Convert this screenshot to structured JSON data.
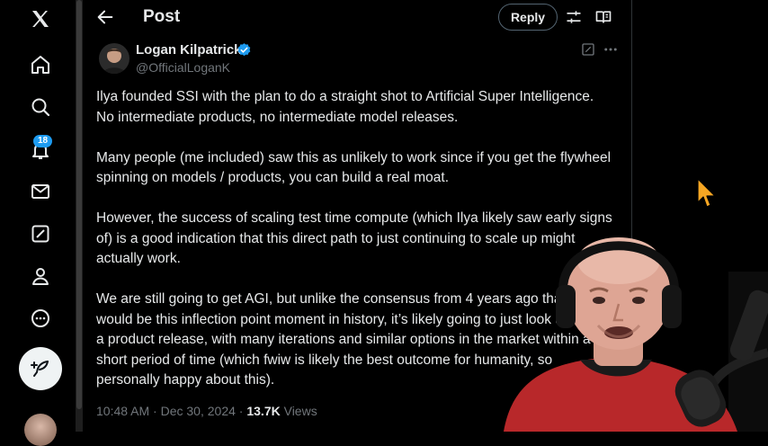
{
  "nav": {
    "notifications_badge": "18",
    "items": [
      "x-logo-icon",
      "home-icon",
      "search-icon",
      "bell-icon",
      "mail-icon",
      "grok-icon",
      "profile-icon",
      "more-circle-icon"
    ]
  },
  "header": {
    "title": "Post",
    "reply_label": "Reply"
  },
  "post": {
    "author_name": "Logan Kilpatrick",
    "handle": "@OfficialLoganK",
    "paragraphs": [
      "Ilya founded SSI with the plan to do a straight shot to Artificial Super Intelligence. No intermediate products, no intermediate model releases.",
      "Many people (me included) saw this as unlikely to work since if you get the flywheel spinning on models / products, you can build a real moat.",
      "However, the success of scaling test time compute (which Ilya likely saw early signs of) is a good indication that this direct path to just continuing to scale up might actually work.",
      "We are still going to get AGI, but unlike the consensus from 4 years ago that it would be this inflection point moment in history, it’s likely going to just look a lot like a product release, with many iterations and similar options in the market within a short period of time (which fwiw is likely the best outcome for humanity, so personally happy about this)."
    ],
    "time": "10:48 AM",
    "date": "Dec 30, 2024",
    "views_count": "13.7K",
    "views_label": "Views"
  },
  "colors": {
    "background": "#000000",
    "accent": "#1d9bf0",
    "text": "#e7e9ea",
    "muted": "#71767b"
  }
}
